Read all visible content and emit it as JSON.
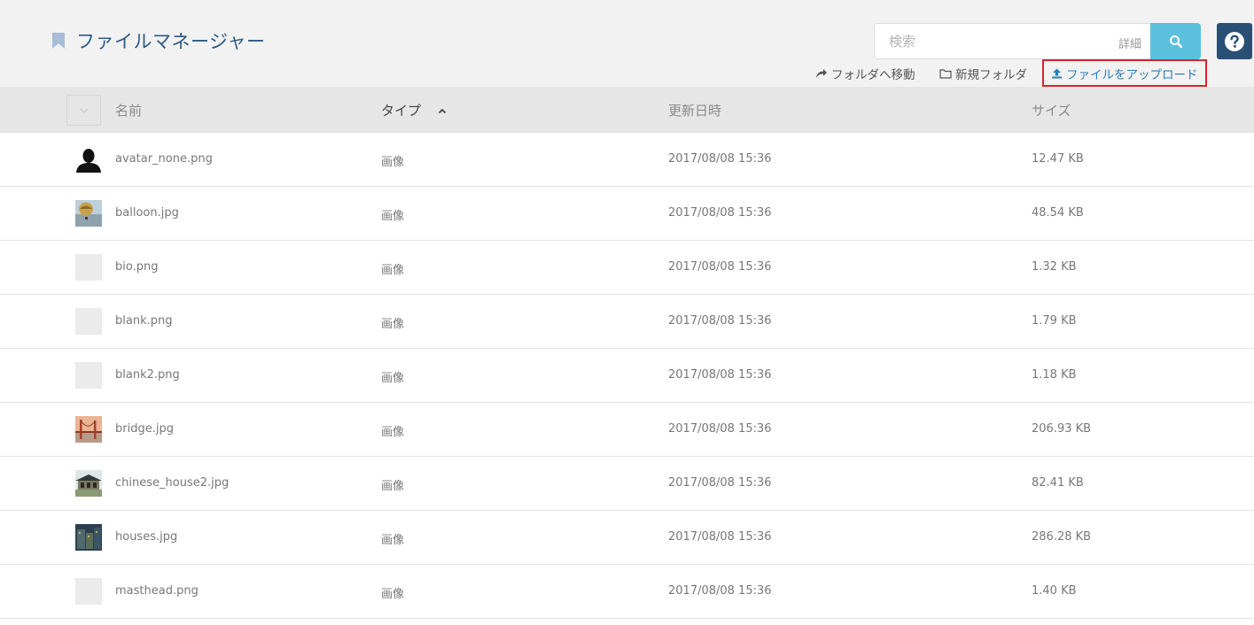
{
  "header": {
    "title": "ファイルマネージャー",
    "search_placeholder": "検索",
    "search_detail": "詳細",
    "actions": {
      "move": "フォルダへ移動",
      "new_folder": "新規フォルダ",
      "upload": "ファイルをアップロード"
    }
  },
  "table": {
    "columns": {
      "name": "名前",
      "type": "タイプ",
      "date": "更新日時",
      "size": "サイズ"
    },
    "rows": [
      {
        "name": "avatar_none.png",
        "type": "画像",
        "date": "2017/08/08 15:36",
        "size": "12.47 KB",
        "thumb": "avatar"
      },
      {
        "name": "balloon.jpg",
        "type": "画像",
        "date": "2017/08/08 15:36",
        "size": "48.54 KB",
        "thumb": "balloon"
      },
      {
        "name": "bio.png",
        "type": "画像",
        "date": "2017/08/08 15:36",
        "size": "1.32 KB",
        "thumb": "blank"
      },
      {
        "name": "blank.png",
        "type": "画像",
        "date": "2017/08/08 15:36",
        "size": "1.79 KB",
        "thumb": "blank"
      },
      {
        "name": "blank2.png",
        "type": "画像",
        "date": "2017/08/08 15:36",
        "size": "1.18 KB",
        "thumb": "blank"
      },
      {
        "name": "bridge.jpg",
        "type": "画像",
        "date": "2017/08/08 15:36",
        "size": "206.93 KB",
        "thumb": "bridge"
      },
      {
        "name": "chinese_house2.jpg",
        "type": "画像",
        "date": "2017/08/08 15:36",
        "size": "82.41 KB",
        "thumb": "house"
      },
      {
        "name": "houses.jpg",
        "type": "画像",
        "date": "2017/08/08 15:36",
        "size": "286.28 KB",
        "thumb": "houses"
      },
      {
        "name": "masthead.png",
        "type": "画像",
        "date": "2017/08/08 15:36",
        "size": "1.40 KB",
        "thumb": "blank"
      }
    ]
  },
  "colors": {
    "title": "#2d5a86",
    "search_button": "#5bc0de",
    "help_button": "#2a4f75",
    "upload_link": "#2b7fb8",
    "highlight_border": "#d9232d"
  },
  "icons": {
    "bookmark": "bookmark-icon",
    "search": "search-icon",
    "help": "help-icon",
    "move": "share-arrow-icon",
    "folder": "folder-icon",
    "upload": "upload-icon",
    "sort": "sort-ascending-icon",
    "checkbox_toggle": "chevron-down-icon"
  }
}
